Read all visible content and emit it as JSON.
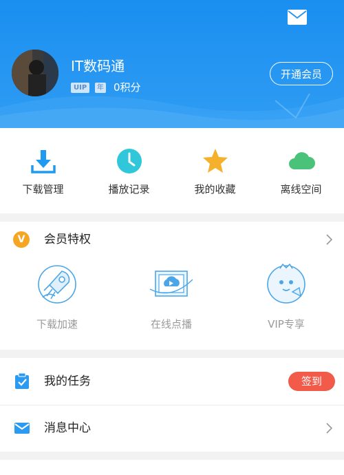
{
  "profile": {
    "username": "IT数码通",
    "vip_badge": "UIP",
    "year_badge": "年",
    "points": "0积分",
    "open_vip_label": "开通会员"
  },
  "quick_actions": [
    {
      "label": "下载管理",
      "icon": "download-icon",
      "color": "#1e9af0"
    },
    {
      "label": "播放记录",
      "icon": "clock-icon",
      "color": "#2fc7d9"
    },
    {
      "label": "我的收藏",
      "icon": "star-icon",
      "color": "#f6b12c"
    },
    {
      "label": "离线空间",
      "icon": "cloud-icon",
      "color": "#4bc27a"
    }
  ],
  "member": {
    "title": "会员特权",
    "badge_letter": "V",
    "items": [
      {
        "label": "下载加速",
        "icon": "rocket-icon"
      },
      {
        "label": "在线点播",
        "icon": "video-screen-icon"
      },
      {
        "label": "VIP专享",
        "icon": "mascot-icon"
      }
    ]
  },
  "list": {
    "tasks_label": "我的任务",
    "signin_label": "签到",
    "messages_label": "消息中心"
  },
  "colors": {
    "header_blue": "#1a8ff0",
    "accent_red": "#f25a4a",
    "vip_orange": "#f6a623"
  }
}
